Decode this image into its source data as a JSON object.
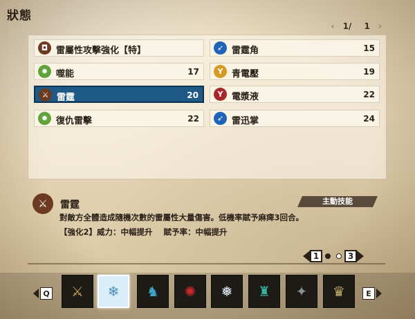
{
  "header": {
    "title": "狀態",
    "page_current": "1/",
    "page_total": "1"
  },
  "skills_left": [
    {
      "name": "雷屬性攻擊強化【特】",
      "level": "",
      "icon": "shield-emblem-icon",
      "color": "brown"
    },
    {
      "name": "噬能",
      "level": "17",
      "icon": "splat-icon",
      "color": "green"
    },
    {
      "name": "雷霆",
      "level": "20",
      "icon": "sword-burst-icon",
      "color": "brown",
      "selected": true
    },
    {
      "name": "復仇雷擊",
      "level": "22",
      "icon": "splat-icon",
      "color": "green"
    }
  ],
  "skills_right": [
    {
      "name": "雷霆角",
      "level": "15",
      "icon": "runner-icon",
      "color": "blue"
    },
    {
      "name": "青電壓",
      "level": "19",
      "icon": "figure-icon",
      "color": "orange"
    },
    {
      "name": "電漿液",
      "level": "22",
      "icon": "figure-icon",
      "color": "red"
    },
    {
      "name": "雷迅掌",
      "level": "24",
      "icon": "runner-icon",
      "color": "blue"
    }
  ],
  "detail": {
    "name": "雷霆",
    "tag": "主動技能",
    "description": "對敵方全體造成隨機次數的雷屬性大量傷害。低機率賦予麻痺3回合。",
    "upgrade_label": "【強化2】威力：中幅提升",
    "upgrade_rate": "賦予率：中幅提升",
    "icon": "sword-burst-icon"
  },
  "page_nav": {
    "current": "1",
    "total": "3"
  },
  "bottom": {
    "key_left": "Q",
    "key_right": "E",
    "monsters": [
      "monster-1",
      "monster-2",
      "monster-3",
      "monster-4",
      "monster-5",
      "monster-6",
      "monster-7",
      "monster-8"
    ],
    "selected_index": 1
  },
  "colors": {
    "selected": "#1f5a86",
    "accent_dark": "#2a2118"
  }
}
